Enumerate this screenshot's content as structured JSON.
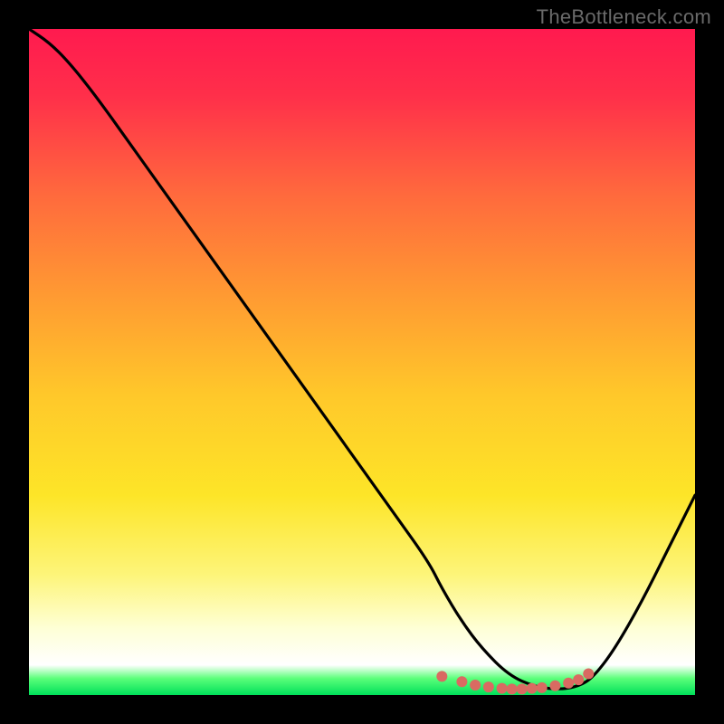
{
  "watermark": "TheBottleneck.com",
  "chart_data": {
    "type": "line",
    "title": "",
    "xlabel": "",
    "ylabel": "",
    "xlim": [
      0,
      100
    ],
    "ylim": [
      0,
      100
    ],
    "gradient_stops": [
      {
        "offset": 0.0,
        "color": "#ff1a4f"
      },
      {
        "offset": 0.1,
        "color": "#ff2f4a"
      },
      {
        "offset": 0.25,
        "color": "#ff6a3d"
      },
      {
        "offset": 0.4,
        "color": "#ff9a32"
      },
      {
        "offset": 0.55,
        "color": "#ffc82a"
      },
      {
        "offset": 0.7,
        "color": "#fde528"
      },
      {
        "offset": 0.82,
        "color": "#fdf57a"
      },
      {
        "offset": 0.9,
        "color": "#feffd6"
      },
      {
        "offset": 0.955,
        "color": "#ffffff"
      },
      {
        "offset": 0.975,
        "color": "#5cff7a"
      },
      {
        "offset": 1.0,
        "color": "#00e05a"
      }
    ],
    "series": [
      {
        "name": "bottleneck-curve",
        "color": "#000000",
        "x": [
          0,
          3,
          6,
          10,
          15,
          20,
          25,
          30,
          35,
          40,
          45,
          50,
          55,
          60,
          62,
          65,
          68,
          72,
          76,
          80,
          83,
          85,
          88,
          92,
          96,
          100
        ],
        "y": [
          100,
          98,
          95,
          90,
          83,
          76,
          69,
          62,
          55,
          48,
          41,
          34,
          27,
          20,
          16,
          11,
          7,
          3,
          1.2,
          0.8,
          1.5,
          3,
          7,
          14,
          22,
          30
        ]
      }
    ],
    "markers": {
      "name": "highlight-dots",
      "color": "#d96a62",
      "radius": 6,
      "x": [
        62,
        65,
        67,
        69,
        71,
        72.5,
        74,
        75.5,
        77,
        79,
        81,
        82.5,
        84
      ],
      "y": [
        2.8,
        2.0,
        1.5,
        1.2,
        1.0,
        0.9,
        0.9,
        1.0,
        1.1,
        1.4,
        1.8,
        2.3,
        3.2
      ]
    }
  }
}
